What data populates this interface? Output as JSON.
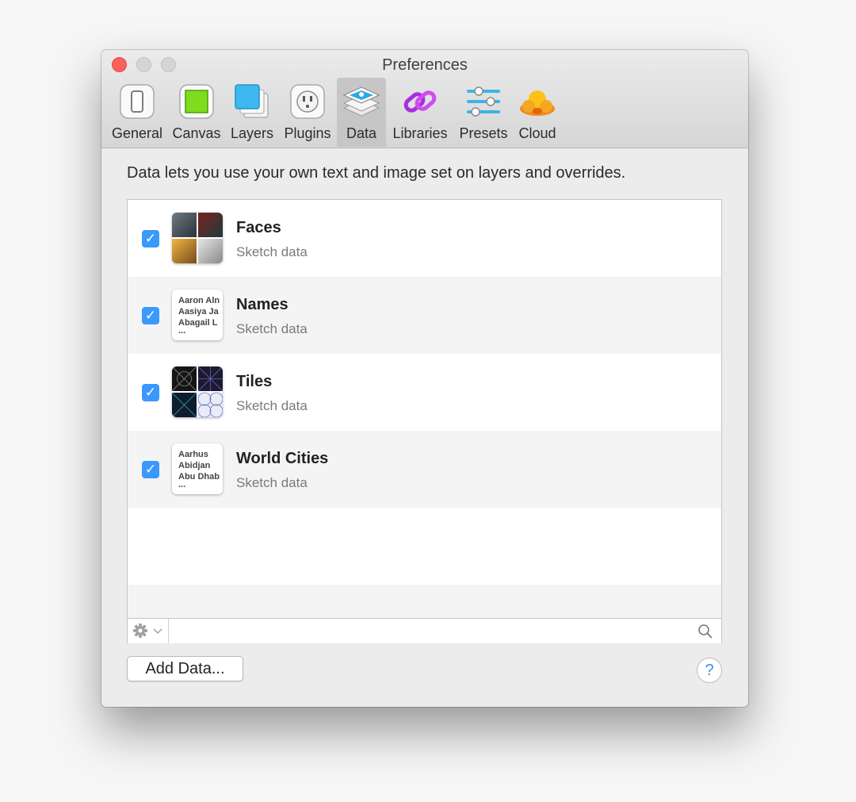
{
  "window": {
    "title": "Preferences"
  },
  "tabs": [
    {
      "label": "General",
      "icon": "phone-icon"
    },
    {
      "label": "Canvas",
      "icon": "canvas-icon"
    },
    {
      "label": "Layers",
      "icon": "layers-icon"
    },
    {
      "label": "Plugins",
      "icon": "plug-icon"
    },
    {
      "label": "Data",
      "icon": "data-icon",
      "active": true
    },
    {
      "label": "Libraries",
      "icon": "link-icon"
    },
    {
      "label": "Presets",
      "icon": "sliders-icon"
    },
    {
      "label": "Cloud",
      "icon": "cloud-icon"
    }
  ],
  "content": {
    "description": "Data lets you use your own text and image set on layers and overrides."
  },
  "data_items": [
    {
      "title": "Faces",
      "subtitle": "Sketch data",
      "checked": true
    },
    {
      "title": "Names",
      "subtitle": "Sketch data",
      "checked": true,
      "preview_lines": [
        "Aaron Aln",
        "Aasiya Ja",
        "Abagail L",
        "..."
      ]
    },
    {
      "title": "Tiles",
      "subtitle": "Sketch data",
      "checked": true
    },
    {
      "title": "World Cities",
      "subtitle": "Sketch data",
      "checked": true,
      "preview_lines": [
        "Aarhus",
        "Abidjan",
        "Abu Dhab",
        "..."
      ]
    }
  ],
  "footer": {
    "add_button": "Add Data...",
    "help_button": "?"
  },
  "colors": {
    "accent": "#3b99fc",
    "close": "#fc605c"
  }
}
